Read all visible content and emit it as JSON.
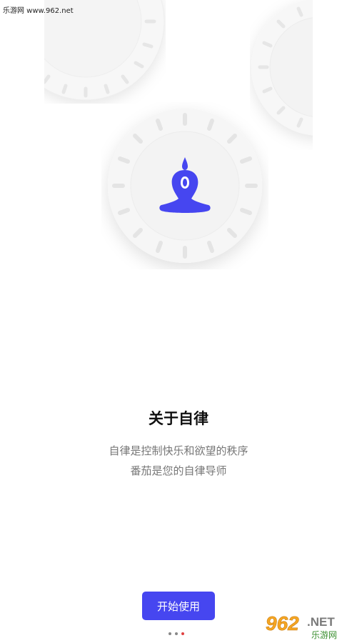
{
  "watermark": {
    "top_text": "乐游网 www.962.net",
    "logo_main": "962",
    "logo_net": ".NET",
    "logo_sub": "乐游网"
  },
  "content": {
    "title": "关于自律",
    "desc_line1": "自律是控制快乐和欲望的秩序",
    "desc_line2": "番茄是您的自律导师"
  },
  "actions": {
    "start_label": "开始使用"
  },
  "pager": {
    "count": 3,
    "active_index": 2
  },
  "colors": {
    "accent": "#4646f0",
    "dot_active": "#e04040",
    "dot": "#888888",
    "text_muted": "#777777"
  },
  "icons": {
    "center": "yoga-meditation-icon",
    "decor": "dial-ring-decoration"
  }
}
